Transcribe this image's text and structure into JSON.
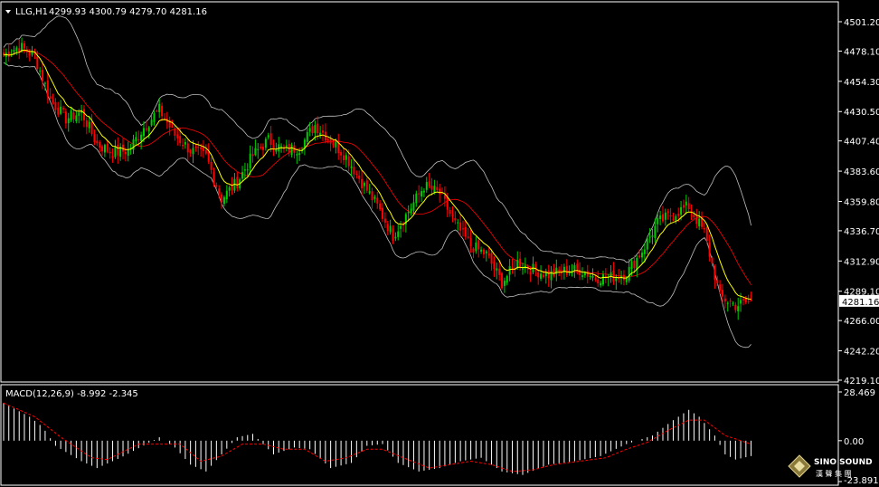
{
  "header": {
    "symbol": "LLG,H1",
    "ohlc": "4299.93 4300.79 4279.70 4281.16"
  },
  "macd": {
    "label": "MACD(12,26,9) -8.992 -2.345",
    "axis_ticks": [
      "28.469",
      "0.00",
      "-23.891"
    ]
  },
  "price_axis": {
    "ticks": [
      "4501.20",
      "4478.10",
      "4454.30",
      "4430.50",
      "4407.40",
      "4383.60",
      "4359.80",
      "4336.70",
      "4312.90",
      "4289.10",
      "4266.00",
      "4242.20",
      "4219.10"
    ],
    "current_price_label": "4281.16"
  },
  "logo": {
    "name": "SINO SOUND",
    "sub": "漢 聲 集 團"
  },
  "colors": {
    "background": "#000000",
    "bull": "#00cc00",
    "bear": "#ff0000",
    "bands": "#c0c0c0",
    "ma": "#ffff00",
    "macd_hist": "#ffffff",
    "macd_signal": "#ff0000",
    "frame": "#ffffff"
  },
  "chart_data": {
    "type": "candlestick",
    "ylim": [
      4219.1,
      4501.2
    ],
    "macd_ylim": [
      -23.891,
      28.469
    ],
    "anchors": [
      [
        0,
        4475
      ],
      [
        6,
        4482
      ],
      [
        12,
        4474
      ],
      [
        18,
        4440
      ],
      [
        24,
        4425
      ],
      [
        30,
        4430
      ],
      [
        36,
        4405
      ],
      [
        42,
        4398
      ],
      [
        48,
        4400
      ],
      [
        54,
        4418
      ],
      [
        60,
        4432
      ],
      [
        66,
        4412
      ],
      [
        72,
        4400
      ],
      [
        78,
        4395
      ],
      [
        84,
        4362
      ],
      [
        90,
        4375
      ],
      [
        96,
        4396
      ],
      [
        102,
        4408
      ],
      [
        108,
        4400
      ],
      [
        114,
        4402
      ],
      [
        120,
        4420
      ],
      [
        126,
        4408
      ],
      [
        132,
        4395
      ],
      [
        138,
        4375
      ],
      [
        144,
        4356
      ],
      [
        150,
        4333
      ],
      [
        156,
        4352
      ],
      [
        162,
        4372
      ],
      [
        168,
        4366
      ],
      [
        174,
        4342
      ],
      [
        180,
        4325
      ],
      [
        186,
        4318
      ],
      [
        192,
        4296
      ],
      [
        198,
        4312
      ],
      [
        204,
        4306
      ],
      [
        210,
        4302
      ],
      [
        216,
        4305
      ],
      [
        222,
        4306
      ],
      [
        228,
        4300
      ],
      [
        234,
        4300
      ],
      [
        240,
        4303
      ],
      [
        246,
        4321
      ],
      [
        252,
        4343
      ],
      [
        258,
        4350
      ],
      [
        264,
        4356
      ],
      [
        270,
        4335
      ],
      [
        276,
        4285
      ],
      [
        282,
        4278
      ],
      [
        288,
        4281
      ]
    ],
    "macd_hist": [
      [
        0,
        22
      ],
      [
        10,
        14
      ],
      [
        15,
        8
      ],
      [
        20,
        -3
      ],
      [
        30,
        -12
      ],
      [
        36,
        -16
      ],
      [
        45,
        -10
      ],
      [
        55,
        -2
      ],
      [
        60,
        2
      ],
      [
        66,
        -4
      ],
      [
        72,
        -14
      ],
      [
        78,
        -18
      ],
      [
        84,
        -8
      ],
      [
        90,
        2
      ],
      [
        96,
        4
      ],
      [
        104,
        -8
      ],
      [
        112,
        -4
      ],
      [
        118,
        -5
      ],
      [
        126,
        -16
      ],
      [
        134,
        -13
      ],
      [
        140,
        -3
      ],
      [
        146,
        -2
      ],
      [
        152,
        -13
      ],
      [
        160,
        -18
      ],
      [
        168,
        -16
      ],
      [
        176,
        -12
      ],
      [
        184,
        -10
      ],
      [
        192,
        -18
      ],
      [
        200,
        -20
      ],
      [
        210,
        -14
      ],
      [
        220,
        -12
      ],
      [
        230,
        -9
      ],
      [
        240,
        -2
      ],
      [
        250,
        3
      ],
      [
        258,
        12
      ],
      [
        264,
        18
      ],
      [
        268,
        14
      ],
      [
        274,
        3
      ],
      [
        278,
        -8
      ],
      [
        282,
        -11
      ],
      [
        288,
        -9
      ]
    ],
    "macd_signal": [
      [
        0,
        22
      ],
      [
        12,
        14
      ],
      [
        22,
        2
      ],
      [
        34,
        -10
      ],
      [
        40,
        -11
      ],
      [
        52,
        -2
      ],
      [
        60,
        -2
      ],
      [
        68,
        -2
      ],
      [
        76,
        -12
      ],
      [
        84,
        -9
      ],
      [
        92,
        -2
      ],
      [
        100,
        -2
      ],
      [
        108,
        -5
      ],
      [
        116,
        -5
      ],
      [
        124,
        -12
      ],
      [
        132,
        -10
      ],
      [
        140,
        -5
      ],
      [
        146,
        -5
      ],
      [
        154,
        -10
      ],
      [
        164,
        -16
      ],
      [
        172,
        -14
      ],
      [
        180,
        -12
      ],
      [
        188,
        -14
      ],
      [
        196,
        -18
      ],
      [
        204,
        -17
      ],
      [
        212,
        -14
      ],
      [
        222,
        -12
      ],
      [
        232,
        -10
      ],
      [
        240,
        -5
      ],
      [
        248,
        -1
      ],
      [
        256,
        6
      ],
      [
        264,
        12
      ],
      [
        270,
        12
      ],
      [
        278,
        3
      ],
      [
        288,
        -2
      ]
    ]
  }
}
